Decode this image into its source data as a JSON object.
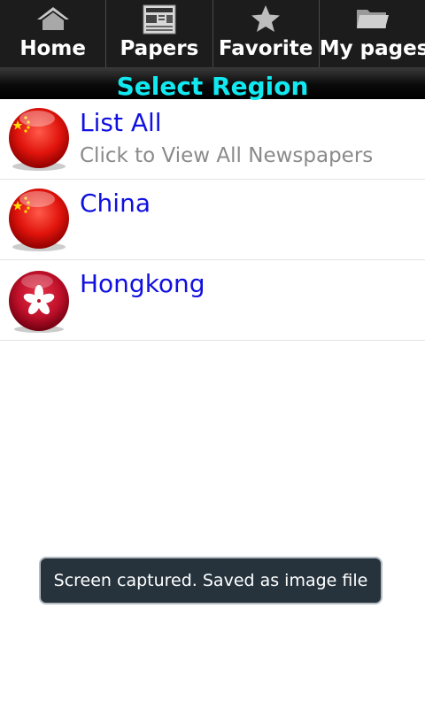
{
  "tabs": [
    {
      "label": "Home",
      "icon": "home-icon"
    },
    {
      "label": "Papers",
      "icon": "newspaper-icon"
    },
    {
      "label": "Favorite",
      "icon": "star-icon"
    },
    {
      "label": "My pages",
      "icon": "folder-icon"
    }
  ],
  "header": {
    "title": "Select Region"
  },
  "regions": [
    {
      "title": "List All",
      "subtitle": "Click to View All Newspapers",
      "flag": "china-flag-icon"
    },
    {
      "title": "China",
      "subtitle": "",
      "flag": "china-flag-icon"
    },
    {
      "title": "Hongkong",
      "subtitle": "",
      "flag": "hongkong-flag-icon"
    }
  ],
  "toast": {
    "message": "Screen captured. Saved as image file"
  },
  "colors": {
    "title_accent": "#12e8f0",
    "link_blue": "#1010e0",
    "toast_bg": "#26333d"
  }
}
